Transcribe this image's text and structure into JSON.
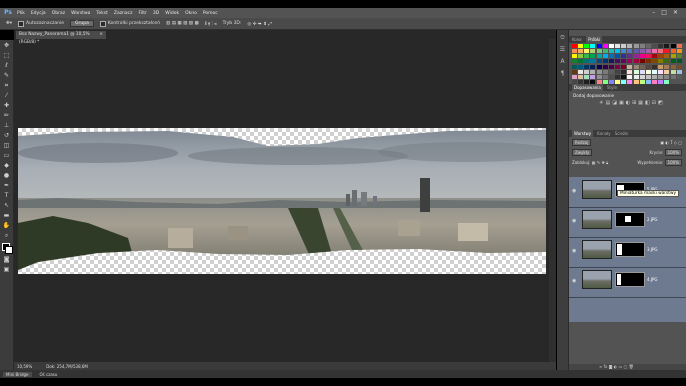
{
  "app": {
    "logo": "Ps"
  },
  "menu": [
    "Plik",
    "Edycja",
    "Obraz",
    "Warstwa",
    "Tekst",
    "Zaznacz",
    "Filtr",
    "3D",
    "Widok",
    "Okno",
    "Pomoc"
  ],
  "window_controls": {
    "minimize": "–",
    "maximize": "□",
    "close": "✕"
  },
  "options": {
    "auto_select_label": "Autozaznaczanie",
    "auto_select_value": "Grupa",
    "transform_controls_label": "Kontrolki przekształceń",
    "mode_label": "Tryb 3D:"
  },
  "document": {
    "tab_title": "Bez Nazwy_Panorama1 @ 10,5% (RGB/8) *",
    "tab_close": "×",
    "zoom": "10,59%",
    "doc_info": "Dok: 254,7M/538,6M"
  },
  "bottom": {
    "active_tab": "Mini Bridge",
    "other_tab": "Oś czasu"
  },
  "panels": {
    "colors_tabs": [
      "Kolor",
      "Próbki"
    ],
    "adjust_tabs": [
      "Dopasowania",
      "Style"
    ],
    "adjust_title": "Dodaj dopasowanie",
    "adjust_icons": [
      "☀",
      "▤",
      "◪",
      "▣",
      "◐",
      "⊞",
      "▦",
      "◧",
      "⊟",
      "◩"
    ],
    "layers_tabs": [
      "Warstwy",
      "Kanały",
      "Ścieżki"
    ],
    "layer_filter": "Rodzaj",
    "blend_mode": "Zwykły",
    "opacity_label": "Krycie:",
    "opacity_value": "100%",
    "lock_label": "Zablokuj:",
    "fill_label": "Wypełnienie:",
    "fill_value": "100%",
    "layers": [
      "5.JPG",
      "2.JPG",
      "3.JPG",
      "4.JPG"
    ],
    "tooltip": "Miniaturka maski warstwy"
  },
  "swatch_colors": [
    "#ff0000",
    "#ffff00",
    "#00ff00",
    "#00ffff",
    "#0000ff",
    "#ff00ff",
    "#ffffff",
    "#e6e6e6",
    "#cccccc",
    "#b3b3b3",
    "#999999",
    "#808080",
    "#666666",
    "#4d4d4d",
    "#333333",
    "#1a1a1a",
    "#000000",
    "#f26c4f",
    "#f68e56",
    "#fbaf5d",
    "#fff467",
    "#acd372",
    "#7cc576",
    "#3bb878",
    "#1abbb4",
    "#00bff3",
    "#438ccb",
    "#5574b9",
    "#605ca8",
    "#855fa8",
    "#a763a8",
    "#f06ea9",
    "#f26d7d",
    "#ed1c24",
    "#f26522",
    "#f7941d",
    "#fff200",
    "#8dc63f",
    "#39b54a",
    "#00a651",
    "#00a99d",
    "#00aeef",
    "#0072bc",
    "#0054a6",
    "#2e3192",
    "#662d91",
    "#92278f",
    "#ec008c",
    "#ed145b",
    "#9e0b0f",
    "#a0410d",
    "#a36209",
    "#aba000",
    "#598527",
    "#197b30",
    "#007236",
    "#00746b",
    "#0076a3",
    "#004b80",
    "#003471",
    "#1b1464",
    "#440e62",
    "#630460",
    "#9e005d",
    "#9e0039",
    "#790000",
    "#7b2e00",
    "#7d4900",
    "#827b00",
    "#406618",
    "#005e20",
    "#005826",
    "#005952",
    "#005b7f",
    "#003663",
    "#002157",
    "#0d004c",
    "#32004b",
    "#4b0049",
    "#7b0046",
    "#7a0026",
    "#c7b299",
    "#998675",
    "#736357",
    "#534741",
    "#37302d",
    "#c69c6d",
    "#a67c52",
    "#8c6239",
    "#754c24",
    "#603913",
    "#e6e6e6",
    "#cfcfcf",
    "#b0b0b0",
    "#959595",
    "#7a7a7a",
    "#5e5e5e",
    "#444444",
    "#2a2a2a",
    "#ffdddd",
    "#ddffdd",
    "#ddddff",
    "#ffffdd",
    "#ddffff",
    "#ffddff",
    "#f0d0a0",
    "#c0e0a0",
    "#a0c0e0",
    "#e0a0c0",
    "#e0c0a0",
    "#a0e0c0",
    "#c0a0e0",
    "#909090",
    "#707070",
    "#505050",
    "#303030",
    "#101010",
    "#f5f5f5",
    "#ebebeb",
    "#d6d6d6",
    "#c2c2c2",
    "#adadad",
    "#999999",
    "#858585",
    "#707070",
    "#5c5c5c",
    "#474747",
    "#333333",
    "#1f1f1f",
    "#0a0a0a",
    "#ff8080",
    "#80ff80",
    "#8080ff",
    "#ffff80",
    "#80ffff",
    "#ff80ff",
    "#ffc080",
    "#c0ff80",
    "#80c0ff",
    "#ff80c0",
    "#c080ff",
    "#80ffc0"
  ]
}
